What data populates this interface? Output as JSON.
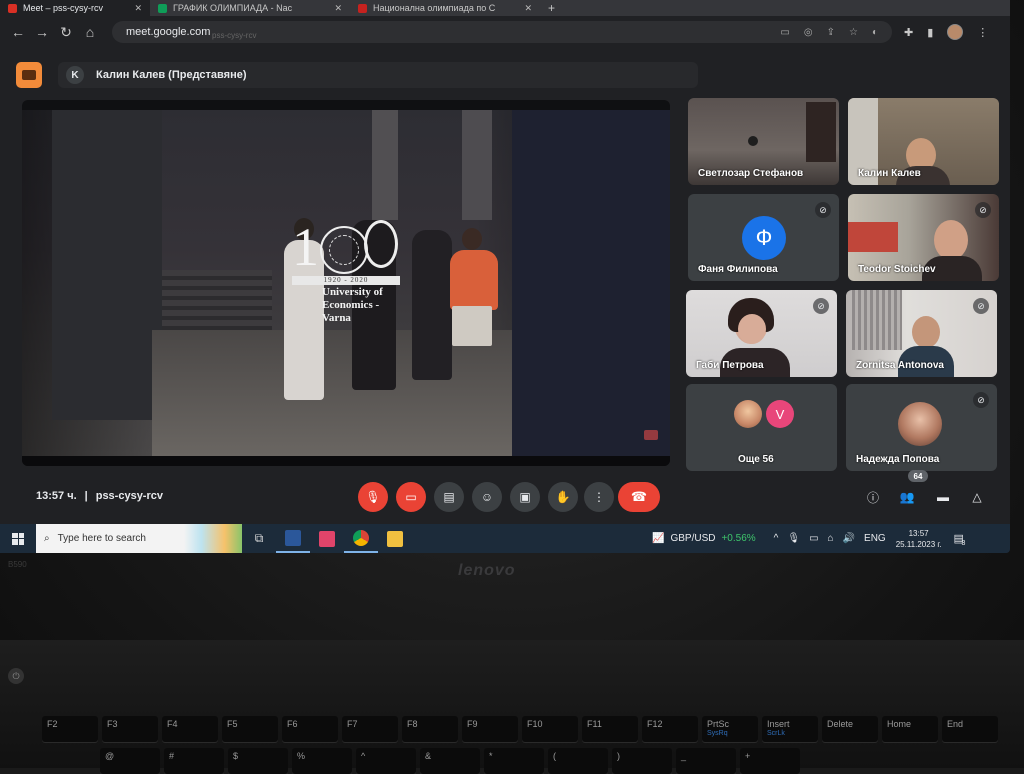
{
  "browser": {
    "tabs": [
      {
        "title": "Meet – pss-cysy-rcv",
        "active": true
      },
      {
        "title": "ГРАФИК ОЛИМПИАДА - Nac",
        "active": false
      },
      {
        "title": "Национална олимпиада по С",
        "active": false
      }
    ],
    "url": "meet.google.com",
    "url_ghost": "pss-cysy-rcv"
  },
  "meet": {
    "presenter_initial": "K",
    "presenter_label": "Калин Калев (Представяне)",
    "meeting_time": "13:57 ч.",
    "separator": "|",
    "meeting_code": "pss-cysy-rcv",
    "participant_count": "64",
    "slide": {
      "number_prefix": "1",
      "year_band": "1920 - 2020",
      "university_line1": "University of",
      "university_line2": "Economics -",
      "university_line3": "Varna"
    },
    "participants": [
      {
        "name": "Светлозар Стефанов",
        "muted": false
      },
      {
        "name": "Калин Калев",
        "muted": false
      },
      {
        "name": "Фаня Филипова",
        "muted": true,
        "initial": "Ф"
      },
      {
        "name": "Teodor Stoichev",
        "muted": true
      },
      {
        "name": "Габи Петрова",
        "muted": true
      },
      {
        "name": "Zornitsa Antonova",
        "muted": true
      },
      {
        "name": "Още 56",
        "muted": false,
        "initial": "V"
      },
      {
        "name": "Надежда Попова",
        "muted": true
      }
    ]
  },
  "taskbar": {
    "search_placeholder": "Type here to search",
    "ticker_symbol": "GBP/USD",
    "ticker_change": "+0.56%",
    "language": "ENG",
    "time": "13:57",
    "date": "25.11.2023 г.",
    "notification_count": "3"
  },
  "laptop": {
    "brand": "lenovo",
    "model": "B590",
    "function_keys": [
      {
        "label": "F2",
        "alt": ""
      },
      {
        "label": "F3",
        "alt": ""
      },
      {
        "label": "F4",
        "alt": ""
      },
      {
        "label": "F5",
        "alt": ""
      },
      {
        "label": "F6",
        "alt": ""
      },
      {
        "label": "F7",
        "alt": ""
      },
      {
        "label": "F8",
        "alt": ""
      },
      {
        "label": "F9",
        "alt": ""
      },
      {
        "label": "F10",
        "alt": ""
      },
      {
        "label": "F11",
        "alt": ""
      },
      {
        "label": "F12",
        "alt": ""
      },
      {
        "label": "PrtSc",
        "alt": "SysRq"
      },
      {
        "label": "Insert",
        "alt": "ScrLk"
      },
      {
        "label": "Delete",
        "alt": ""
      },
      {
        "label": "Home",
        "alt": ""
      },
      {
        "label": "End",
        "alt": ""
      }
    ],
    "number_keys": [
      "@",
      "#",
      "$",
      "%",
      "^",
      "&",
      "*",
      "(",
      ")",
      "_",
      "+"
    ]
  },
  "colors": {
    "meet_accent": "#f28b3a",
    "end_call": "#ea4335",
    "avatar_blue": "#1a73e8",
    "avatar_pink": "#e8467a",
    "ticker_up": "#3ec46b"
  }
}
